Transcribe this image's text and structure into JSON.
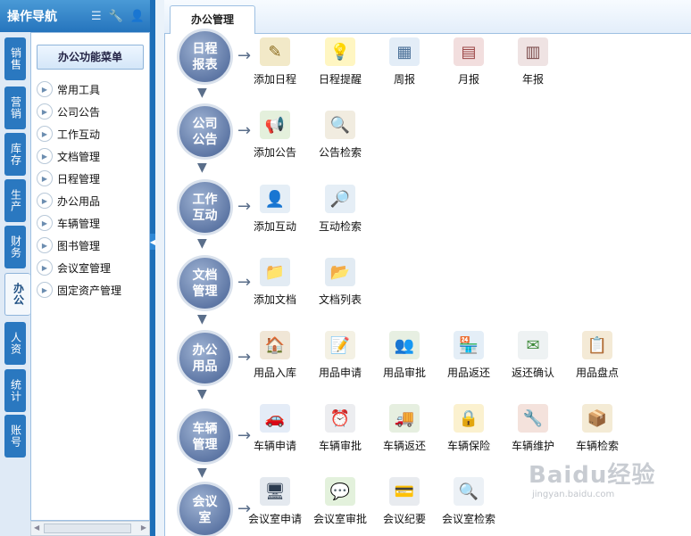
{
  "header": {
    "title": "操作导航",
    "icons": [
      "list-icon",
      "wrench-icon",
      "user-icon"
    ]
  },
  "vtabs": [
    {
      "label": "销售",
      "active": false
    },
    {
      "label": "营销",
      "active": false
    },
    {
      "label": "库存",
      "active": false
    },
    {
      "label": "生产",
      "active": false
    },
    {
      "label": "财务",
      "active": false
    },
    {
      "label": "办公",
      "active": true
    },
    {
      "label": "人资",
      "active": false
    },
    {
      "label": "统计",
      "active": false
    },
    {
      "label": "账号",
      "active": false
    }
  ],
  "menu": {
    "title": "办公功能菜单",
    "items": [
      "常用工具",
      "公司公告",
      "工作互动",
      "文档管理",
      "日程管理",
      "办公用品",
      "车辆管理",
      "图书管理",
      "会议室管理",
      "固定资产管理"
    ]
  },
  "tab": {
    "label": "办公管理"
  },
  "flow": [
    {
      "node": "日程报表",
      "apps": [
        {
          "label": "添加日程",
          "icon": "add-schedule-icon"
        },
        {
          "label": "日程提醒",
          "icon": "bulb-icon"
        },
        {
          "label": "周报",
          "icon": "week-report-icon"
        },
        {
          "label": "月报",
          "icon": "calendar-icon"
        },
        {
          "label": "年报",
          "icon": "year-report-icon"
        }
      ]
    },
    {
      "node": "公司公告",
      "apps": [
        {
          "label": "添加公告",
          "icon": "megaphone-icon"
        },
        {
          "label": "公告检索",
          "icon": "document-search-icon"
        }
      ]
    },
    {
      "node": "工作互动",
      "apps": [
        {
          "label": "添加互动",
          "icon": "add-user-icon"
        },
        {
          "label": "互动检索",
          "icon": "user-search-icon"
        }
      ]
    },
    {
      "node": "文档管理",
      "apps": [
        {
          "label": "添加文档",
          "icon": "folder-add-icon"
        },
        {
          "label": "文档列表",
          "icon": "folder-list-icon"
        }
      ]
    },
    {
      "node": "办公用品",
      "apps": [
        {
          "label": "用品入库",
          "icon": "warehouse-icon"
        },
        {
          "label": "用品申请",
          "icon": "note-pen-icon"
        },
        {
          "label": "用品审批",
          "icon": "approve-person-icon"
        },
        {
          "label": "用品返还",
          "icon": "shop-icon"
        },
        {
          "label": "返还确认",
          "icon": "mail-check-icon"
        },
        {
          "label": "用品盘点",
          "icon": "clipboard-icon"
        }
      ]
    },
    {
      "node": "车辆管理",
      "apps": [
        {
          "label": "车辆申请",
          "icon": "driver-icon"
        },
        {
          "label": "车辆审批",
          "icon": "clock-calendar-icon"
        },
        {
          "label": "车辆返还",
          "icon": "truck-icon"
        },
        {
          "label": "车辆保险",
          "icon": "lock-icon"
        },
        {
          "label": "车辆维护",
          "icon": "car-repair-icon"
        },
        {
          "label": "车辆检索",
          "icon": "stamp-icon"
        }
      ]
    },
    {
      "node": "会议室",
      "apps": [
        {
          "label": "会议室申请",
          "icon": "monitor-icon"
        },
        {
          "label": "会议室审批",
          "icon": "chat-bubbles-icon"
        },
        {
          "label": "会议纪要",
          "icon": "card-reader-icon"
        },
        {
          "label": "会议室检索",
          "icon": "magnifier-icon"
        }
      ]
    }
  ],
  "watermark": {
    "line1": "Baidu经验",
    "line2": "jingyan.baidu.com"
  }
}
